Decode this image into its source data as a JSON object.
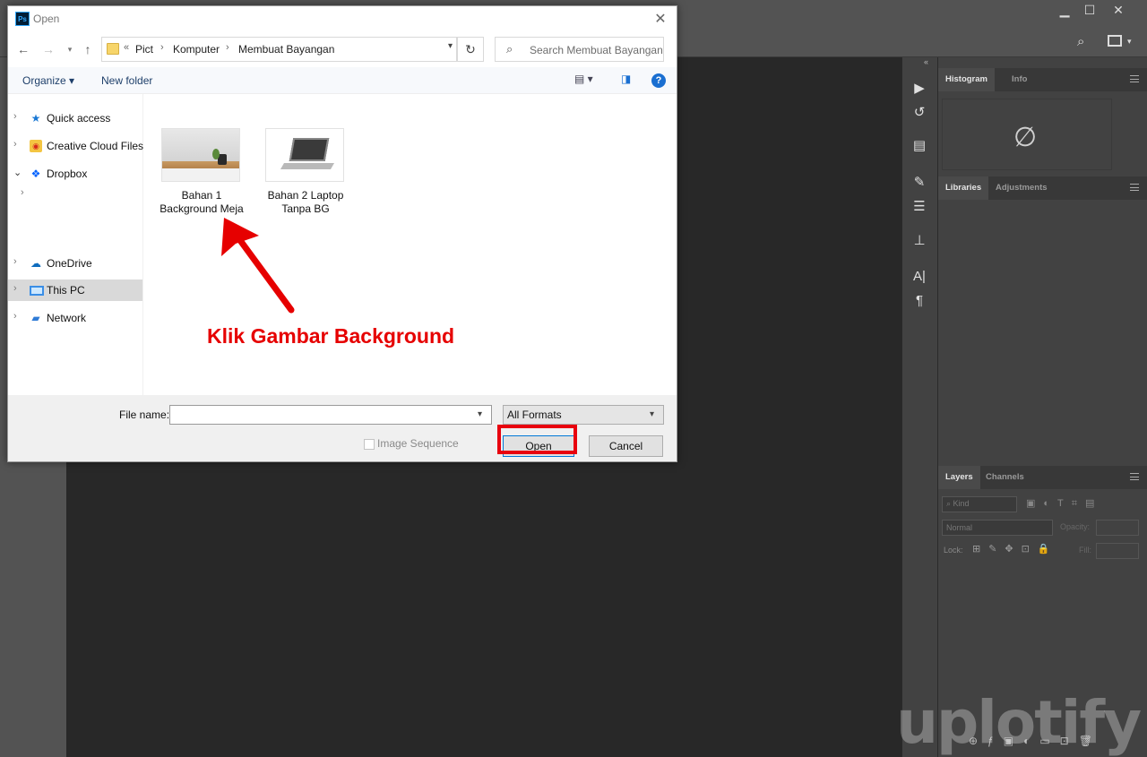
{
  "dialog": {
    "title": "Open",
    "app_badge": "Ps",
    "close_glyph": "✕",
    "breadcrumb": [
      "Pict",
      "Komputer",
      "Membuat Bayangan"
    ],
    "breadcrumb_prefix": "«",
    "search_placeholder": "Search Membuat Bayangan",
    "toolbar": {
      "organize": "Organize ▾",
      "new_folder": "New folder",
      "help": "?"
    },
    "nav_items": [
      {
        "label": "Quick access",
        "icon": "star-icon"
      },
      {
        "label": "Creative Cloud Files",
        "icon": "creative-cloud-icon"
      },
      {
        "label": "Dropbox",
        "icon": "dropbox-icon"
      },
      {
        "label": "OneDrive",
        "icon": "cloud-icon"
      },
      {
        "label": "This PC",
        "icon": "computer-icon"
      },
      {
        "label": "Network",
        "icon": "network-icon"
      }
    ],
    "files": [
      {
        "name": "Bahan 1 Background Meja"
      },
      {
        "name": "Bahan 2 Laptop Tanpa BG"
      }
    ],
    "file_name_label": "File name:",
    "file_name_value": "",
    "format_selected": "All Formats",
    "image_sequence_label": "Image Sequence",
    "open_label": "Open",
    "cancel_label": "Cancel"
  },
  "annotation": {
    "text": "Klik Gambar Background",
    "color": "#e60000"
  },
  "photoshop": {
    "panels": {
      "histogram_tab": "Histogram",
      "info_tab": "Info",
      "libraries_tab": "Libraries",
      "adjustments_tab": "Adjustments",
      "layers_tab": "Layers",
      "channels_tab": "Channels",
      "kind_label": "Kind",
      "blend_mode": "Normal",
      "opacity_label": "Opacity:",
      "lock_label": "Lock:",
      "fill_label": "Fill:"
    }
  },
  "watermark": "uplotify"
}
